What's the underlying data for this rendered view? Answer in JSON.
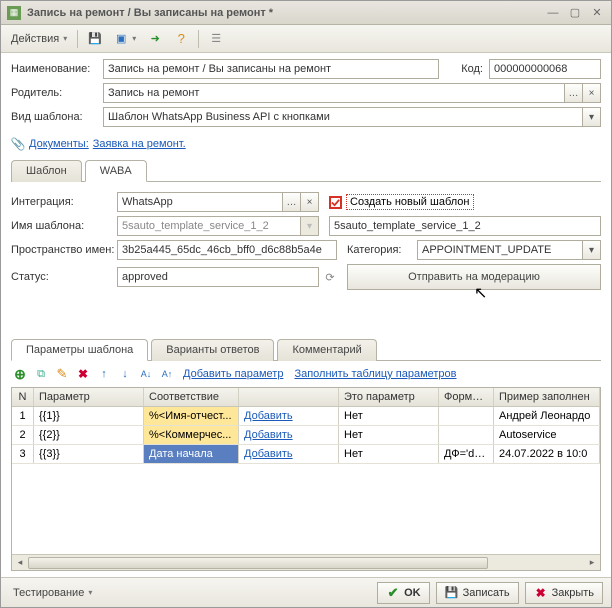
{
  "title": "Запись на ремонт / Вы записаны на ремонт *",
  "toolbar": {
    "actions": "Действия"
  },
  "header": {
    "name_lbl": "Наименование:",
    "name_val": "Запись на ремонт / Вы записаны на ремонт",
    "code_lbl": "Код:",
    "code_val": "000000000068",
    "parent_lbl": "Родитель:",
    "parent_val": "Запись на ремонт",
    "tmpl_type_lbl": "Вид шаблона:",
    "tmpl_type_val": "Шаблон WhatsApp Business API с кнопками"
  },
  "docs": {
    "prefix": "Документы:",
    "link": "Заявка на ремонт."
  },
  "tabs": {
    "t1": "Шаблон",
    "t2": "WABA"
  },
  "waba": {
    "integration_lbl": "Интеграция:",
    "integration_val": "WhatsApp",
    "create_new": "Создать новый шаблон",
    "tmpl_name_lbl": "Имя шаблона:",
    "tmpl_name_gray": "5sauto_template_service_1_2",
    "tmpl_name_val": "5sauto_template_service_1_2",
    "ns_lbl": "Пространство имен:",
    "ns_val": "3b25a445_65dc_46cb_bff0_d6c88b5a4e",
    "cat_lbl": "Категория:",
    "cat_val": "APPOINTMENT_UPDATE",
    "status_lbl": "Статус:",
    "status_val": "approved",
    "moderation_btn": "Отправить на модерацию"
  },
  "ptabs": {
    "t1": "Параметры шаблона",
    "t2": "Варианты ответов",
    "t3": "Комментарий"
  },
  "ptoolbar": {
    "add_param": "Добавить параметр",
    "fill": "Заполнить таблицу параметров"
  },
  "thead": {
    "n": "N",
    "p": "Параметр",
    "s": "Соответствие",
    "d": "",
    "e": "Это параметр",
    "f": "Формат ...",
    "z": "Пример заполнен"
  },
  "rows": [
    {
      "n": "1",
      "p": "{{1}}",
      "s": "%<Имя-отчест...",
      "d": "Добавить",
      "e": "Нет",
      "f": "",
      "z": "Андрей Леонардо"
    },
    {
      "n": "2",
      "p": "{{2}}",
      "s": "%<Коммерчес...",
      "d": "Добавить",
      "e": "Нет",
      "f": "",
      "z": "Autoservice"
    },
    {
      "n": "3",
      "p": "{{3}}",
      "s": "Дата начала",
      "d": "Добавить",
      "e": "Нет",
      "f": "ДФ='dd....",
      "z": "24.07.2022 в 10:0"
    }
  ],
  "bottom": {
    "test": "Тестирование",
    "ok": "OK",
    "save": "Записать",
    "close": "Закрыть"
  }
}
